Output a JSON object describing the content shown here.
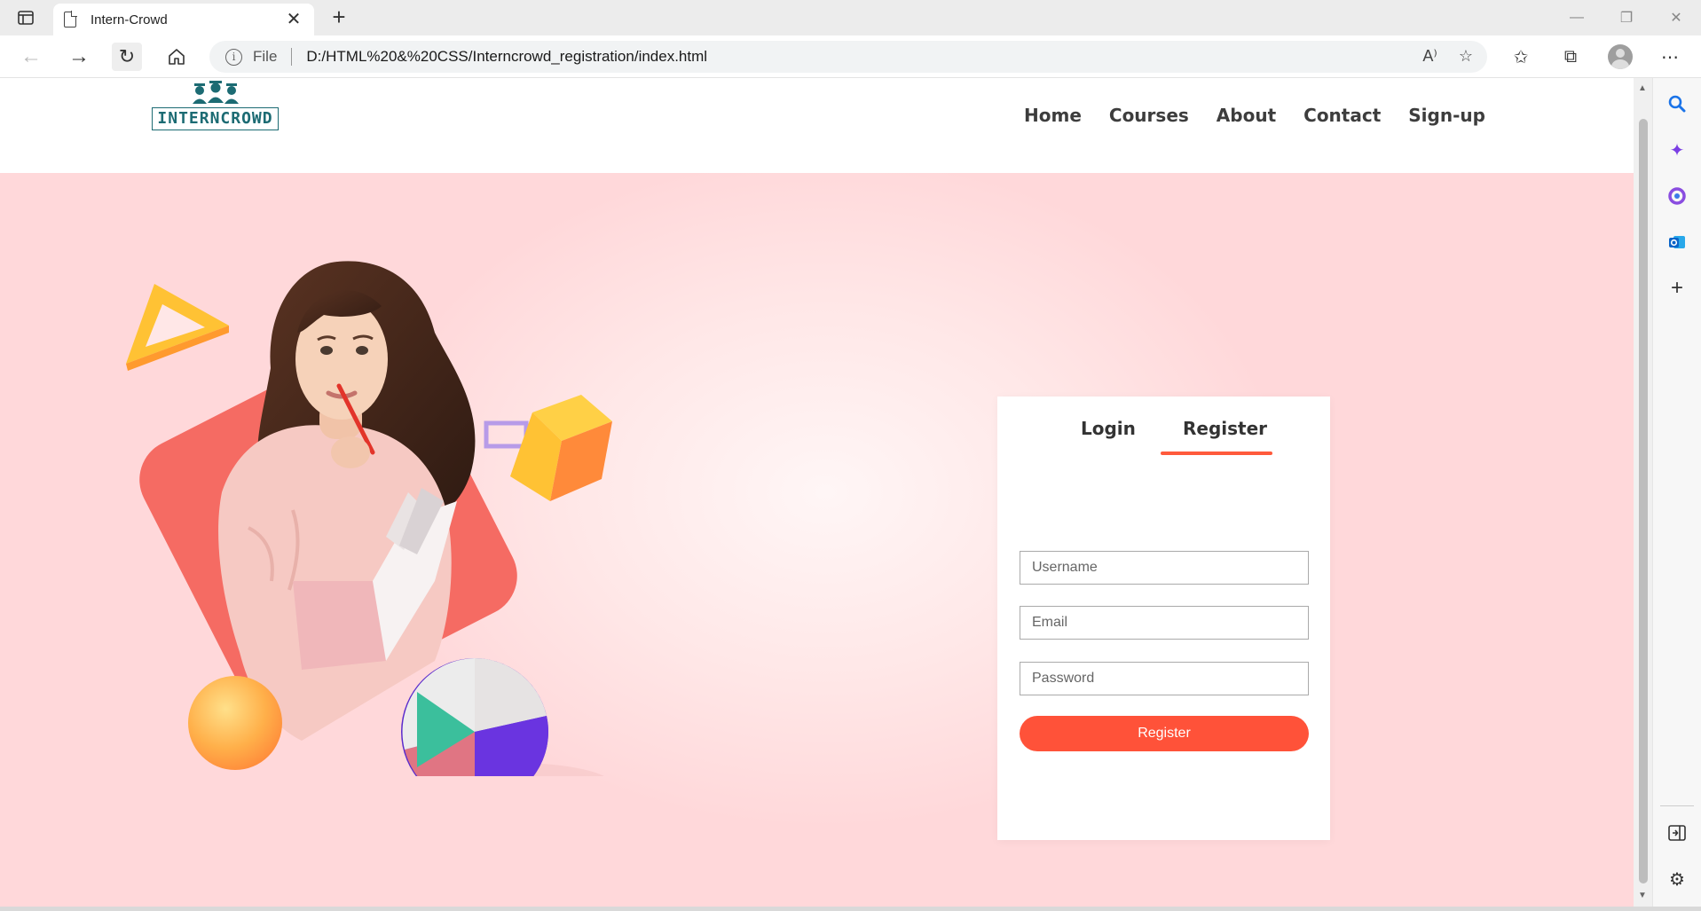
{
  "browser": {
    "tab_title": "Intern-Crowd",
    "tab_close": "✕",
    "new_tab": "+",
    "address_scheme_label": "File",
    "url": "D:/HTML%20&%20CSS/Interncrowd_registration/index.html"
  },
  "site": {
    "logo_text": "INTERNCROWD",
    "nav": [
      "Home",
      "Courses",
      "About",
      "Contact",
      "Sign-up"
    ]
  },
  "form": {
    "tabs": [
      "Login",
      "Register"
    ],
    "active_tab": "Register",
    "username_placeholder": "Username",
    "email_placeholder": "Email",
    "password_placeholder": "Password",
    "submit_label": "Register"
  },
  "colors": {
    "accent": "#ff5239",
    "nav_text": "#3d3d3d",
    "logo": "#1c6b73",
    "hero_bg": "#ffe2e3"
  }
}
